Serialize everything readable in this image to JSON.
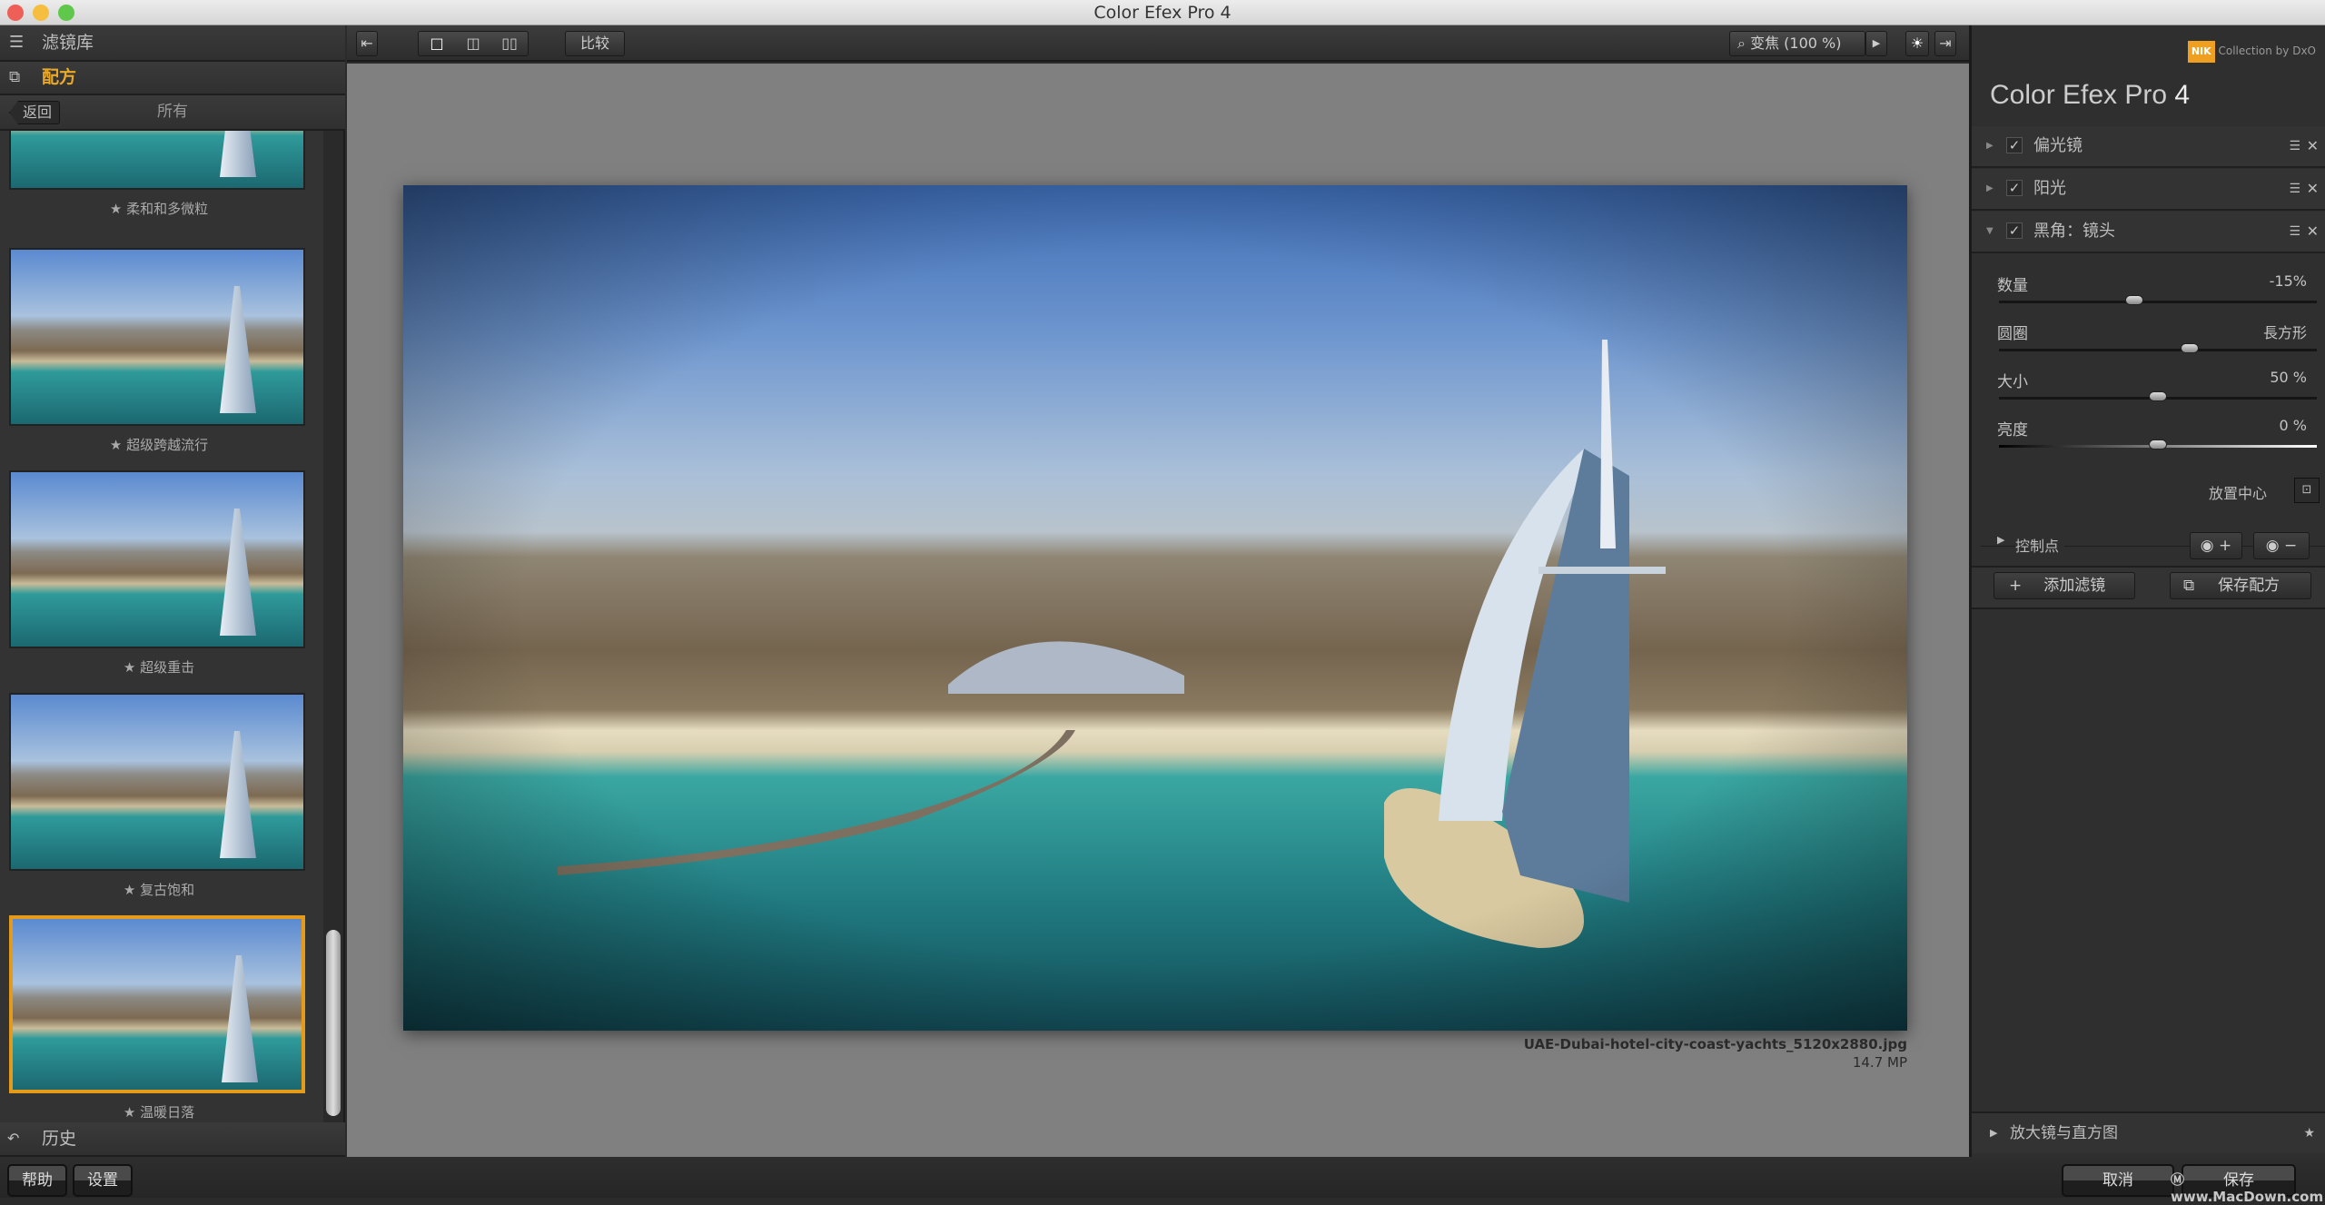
{
  "window": {
    "title": "Color Efex Pro 4"
  },
  "sidebar": {
    "filter_library": "滤镜库",
    "recipes": "配方",
    "back": "返回",
    "category": "所有",
    "presets": [
      {
        "label": "★ 柔和和多微粒",
        "selected": false
      },
      {
        "label": "★ 超级跨越流行",
        "selected": false
      },
      {
        "label": "★ 超级重击",
        "selected": false
      },
      {
        "label": "★ 复古饱和",
        "selected": false
      },
      {
        "label": "★ 温暖日落",
        "selected": true
      }
    ],
    "history": "历史",
    "accent": "#e59a1a"
  },
  "toolbar": {
    "compare": "比较",
    "zoom": "变焦 (100 %)"
  },
  "image": {
    "filename": "UAE-Dubai-hotel-city-coast-yachts_5120x2880.jpg",
    "megapixels": "14.7 MP"
  },
  "rpanel": {
    "brand": "Collection by DxO",
    "brand_logo": "nik",
    "title": "Color Efex Pro",
    "version": "4",
    "filters": [
      {
        "name": "偏光镜",
        "enabled": true,
        "expanded": false
      },
      {
        "name": "阳光",
        "enabled": true,
        "expanded": false
      },
      {
        "name": "黑角：镜头",
        "enabled": true,
        "expanded": true
      }
    ],
    "params": [
      {
        "label": "数量",
        "value": "-15%",
        "position": 0.425
      },
      {
        "label": "圆圈",
        "value": "長方形",
        "position": 0.6
      },
      {
        "label": "大小",
        "value": "50 %",
        "position": 0.5
      },
      {
        "label": "亮度",
        "value": "0 %",
        "position": 0.5
      }
    ],
    "place_center": "放置中心",
    "control_points": "控制点",
    "add_filter": "添加滤镜",
    "save_recipe": "保存配方",
    "loupe": "放大镜与直方图"
  },
  "bottom": {
    "help": "帮助",
    "settings": "设置",
    "cancel": "取消",
    "save": "保存",
    "watermark": "www.MacDown.com"
  }
}
